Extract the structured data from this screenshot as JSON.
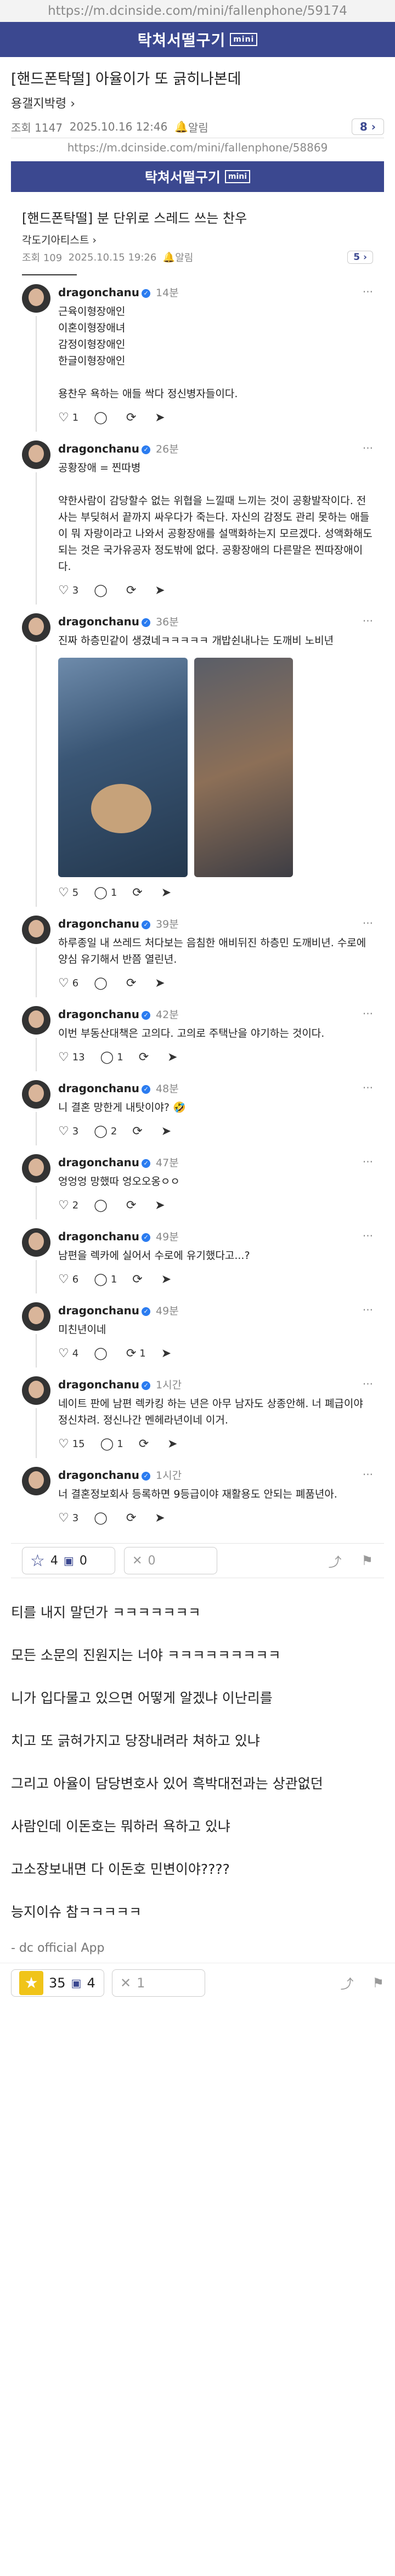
{
  "url_bar": "https://m.dcinside.com/mini/fallenphone/59174",
  "banner": {
    "title": "탁쳐서떨구기",
    "mini_badge": "mini"
  },
  "post": {
    "title": "[핸드폰탁떨] 아율이가 또 긁히나본데",
    "author": "용갤지박령",
    "views_label": "조회 1147",
    "date": "2025.10.16 12:46",
    "bell": "알림",
    "reply_count": "8"
  },
  "inner": {
    "url": "https://m.dcinside.com/mini/fallenphone/58869",
    "banner": "탁쳐서떨구기",
    "title": "[핸드폰탁떨] 분 단위로 스레드 쓰는 찬우",
    "author": "각도기아티스트",
    "views_label": "조회 109",
    "date": "2025.10.15 19:26",
    "bell": "알림",
    "reply_count": "5"
  },
  "thread": [
    {
      "user": "dragonchanu",
      "time": "14분",
      "text": "근육이형장애인\n이혼이형장애녀\n감정이형장애인\n한글이형장애인\n\n용찬우 욕하는 애들 싹다 정신병자들이다.",
      "likes": "1",
      "comments": "",
      "reposts": ""
    },
    {
      "user": "dragonchanu",
      "time": "26분",
      "text": "공황장애 = 찐따병\n\n약한사람이 감당할수 없는 위협을 느낄때 느끼는 것이 공황발작이다. 전사는 부딪혀서 끝까지 싸우다가 죽는다. 자신의 감정도 관리 못하는 애들이 뭐 자랑이라고 나와서 공황장애를 설맥화하는지 모르겠다. 성액화해도 되는 것은 국가유공자 정도밖에 없다. 공황장애의 다른말은 찐따장애이다.",
      "likes": "3",
      "comments": "",
      "reposts": ""
    },
    {
      "user": "dragonchanu",
      "time": "36분",
      "text": "진짜 하층민같이 생겼네ㅋㅋㅋㅋㅋ 개밥쉰내나는 도깨비 노비년",
      "likes": "5",
      "comments": "1",
      "reposts": ""
    },
    {
      "user": "dragonchanu",
      "time": "39분",
      "text": "하루종일 내 쓰레드 처다보는 음침한 애비뒤진 하층민 도깨비년. 수로에 양심 유기해서 반쯤 열린년.",
      "likes": "6",
      "comments": "",
      "reposts": ""
    },
    {
      "user": "dragonchanu",
      "time": "42분",
      "text": "이번 부동산대책은 고의다. 고의로 주택난을 야기하는 것이다.",
      "likes": "13",
      "comments": "1",
      "reposts": ""
    },
    {
      "user": "dragonchanu",
      "time": "48분",
      "text": "니 결혼 망한게 내탓이야? 🤣",
      "likes": "3",
      "comments": "2",
      "reposts": ""
    },
    {
      "user": "dragonchanu",
      "time": "47분",
      "text": "엉엉엉 망했따 엉오오옹ㅇㅇ",
      "likes": "2",
      "comments": "",
      "reposts": ""
    },
    {
      "user": "dragonchanu",
      "time": "49분",
      "text": "남편을 렉카에 실어서 수로에 유기했다고...?",
      "likes": "6",
      "comments": "1",
      "reposts": ""
    },
    {
      "user": "dragonchanu",
      "time": "49분",
      "text": "미친년이네",
      "likes": "4",
      "comments": "",
      "reposts": "1"
    },
    {
      "user": "dragonchanu",
      "time": "1시간",
      "text": "네이트 판에 남편 렉카킹 하는 년은 아무 남자도 상종안해. 너 폐급이야 정신차려. 정신나간 멘헤라년이네 이거.",
      "likes": "15",
      "comments": "1",
      "reposts": ""
    },
    {
      "user": "dragonchanu",
      "time": "1시간",
      "text": "너 결혼정보회사 등록하면 9등급이야 재활용도 안되는 폐품년아.",
      "likes": "3",
      "comments": "",
      "reposts": ""
    }
  ],
  "inner_bar": {
    "up_count": "4",
    "up_small": "0",
    "down_count": "0"
  },
  "comments": [
    "티를 내지 말던가 ㅋㅋㅋㅋㅋㅋㅋ",
    "모든 소문의 진원지는 너야 ㅋㅋㅋㅋㅋㅋㅋㅋㅋ",
    "니가 입다물고 있으면 어떻게 알겠냐 이난리를",
    "치고 또 긁혀가지고 당장내려라 쳐하고 있냐",
    "그리고 아율이 담당변호사 있어 흑박대전과는 상관없던",
    "사람인데 이돈호는 뭐하러 욕하고 있냐",
    "고소장보내면 다 이돈호 민변이야????",
    "능지이슈 참ㅋㅋㅋㅋㅋ"
  ],
  "signature": "- dc official App",
  "footer": {
    "up_count": "35",
    "up_small": "4",
    "down_count": "1"
  }
}
